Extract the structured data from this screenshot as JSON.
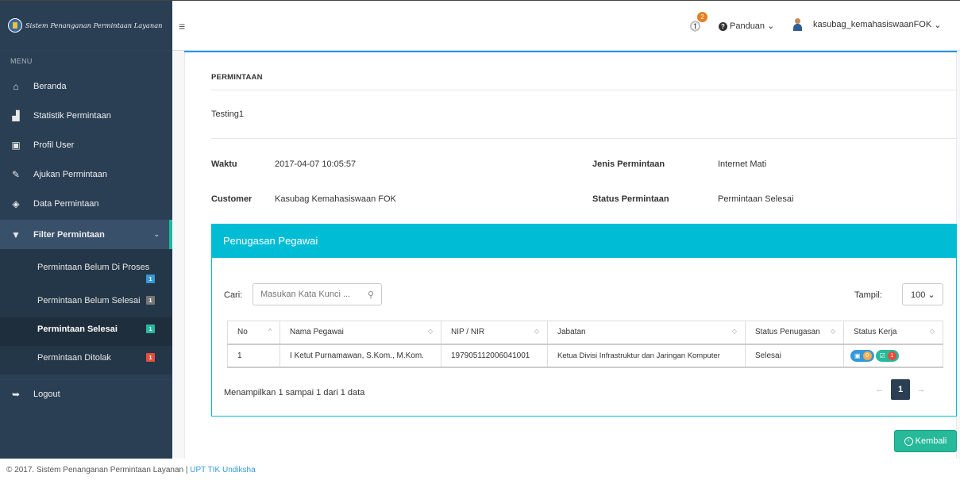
{
  "sidebar": {
    "brand": "Sistem Penanganan Permintaan Layanan",
    "menu_label": "MENU",
    "items": [
      {
        "label": "Beranda",
        "icon": "home-icon"
      },
      {
        "label": "Statistik Permintaan",
        "icon": "bar-chart-icon"
      },
      {
        "label": "Profil User",
        "icon": "user-card-icon"
      },
      {
        "label": "Ajukan Permintaan",
        "icon": "edit-icon"
      },
      {
        "label": "Data Permintaan",
        "icon": "database-icon"
      },
      {
        "label": "Filter Permintaan",
        "icon": "filter-icon"
      }
    ],
    "submenu": [
      {
        "label": "Permintaan Belum Di Proses",
        "badge": "1",
        "color": "#3498db"
      },
      {
        "label": "Permintaan Belum Selesai",
        "badge": "1",
        "color": "#777777"
      },
      {
        "label": "Permintaan Selesai",
        "badge": "1",
        "color": "#26b99a"
      },
      {
        "label": "Permintaan Ditolak",
        "badge": "1",
        "color": "#e74c3c"
      }
    ],
    "logout": "Logout"
  },
  "topnav": {
    "notif_count": "2",
    "panduan": "Panduan",
    "user": "kasubag_kemahasiswaanFOK"
  },
  "detail": {
    "section_title": "PERMINTAAN",
    "subject": "Testing1",
    "waktu_label": "Waktu",
    "waktu_value": "2017-04-07 10:05:57",
    "jenis_label": "Jenis Permintaan",
    "jenis_value": "Internet Mati",
    "customer_label": "Customer",
    "customer_value": "Kasubag Kemahasiswaan FOK",
    "status_label": "Status Permintaan",
    "status_value": "Permintaan Selesai"
  },
  "panel": {
    "title": "Penugasan Pegawai",
    "search_label": "Cari:",
    "search_placeholder": "Masukan Kata Kunci ...",
    "tampil_label": "Tampil:",
    "tampil_value": "100",
    "columns": [
      "No",
      "Nama Pegawai",
      "NIP / NIR",
      "Jabatan",
      "Status Penugasan",
      "Status Kerja"
    ],
    "rows": [
      {
        "no": "1",
        "nama": "I Ketut Purnamawan, S.Kom., M.Kom.",
        "nip": "197905112006041001",
        "jabatan": "Ketua Divisi Infrastruktur dan Jaringan Komputer",
        "status_penugasan": "Selesai",
        "kerja_a": "0",
        "kerja_b": "1"
      }
    ],
    "showing": "Menampilkan 1 sampai 1 dari 1 data",
    "page": "1"
  },
  "back_button": "Kembali",
  "footer": {
    "text": "© 2017. Sistem Penanganan Permintaan Layanan | ",
    "link": "UPT TIK Undiksha"
  }
}
